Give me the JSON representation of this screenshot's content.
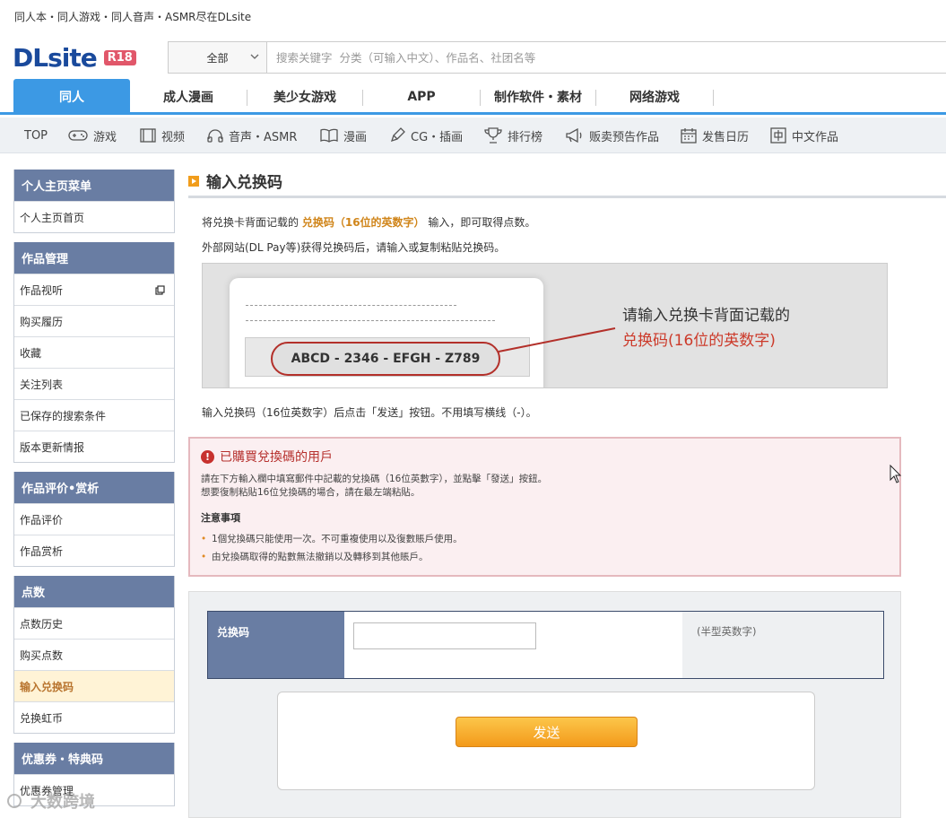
{
  "header": {
    "tagline": "同人本・同人游戏・同人音声・ASMR尽在DLsite",
    "logo_text": "DLsite",
    "logo_badge": "R18",
    "search_category": "全部",
    "search_placeholder": "搜索关键字  分类（可输入中文）、作品名、社团名等"
  },
  "main_nav": [
    "同人",
    "成人漫画",
    "美少女游戏",
    "APP",
    "制作软件・素材",
    "网络游戏"
  ],
  "sub_nav": {
    "top": "TOP",
    "items": [
      {
        "label": "游戏",
        "icon": "gamepad-icon"
      },
      {
        "label": "视频",
        "icon": "film-icon"
      },
      {
        "label": "音声・ASMR",
        "icon": "headphones-icon"
      },
      {
        "label": "漫画",
        "icon": "book-icon"
      },
      {
        "label": "CG・插画",
        "icon": "pen-icon"
      },
      {
        "label": "排行榜",
        "icon": "trophy-icon"
      },
      {
        "label": "贩卖预告作品",
        "icon": "megaphone-icon"
      },
      {
        "label": "发售日历",
        "icon": "calendar-icon"
      },
      {
        "label": "中文作品",
        "icon": "zh-icon"
      }
    ]
  },
  "sidebar": [
    {
      "title": "个人主页菜单",
      "items": [
        {
          "label": "个人主页首页"
        }
      ]
    },
    {
      "title": "作品管理",
      "items": [
        {
          "label": "作品视听",
          "external": true
        },
        {
          "label": "购买履历"
        },
        {
          "label": "收藏"
        },
        {
          "label": "关注列表"
        },
        {
          "label": "已保存的搜索条件"
        },
        {
          "label": "版本更新情报"
        }
      ]
    },
    {
      "title": "作品评价•赏析",
      "items": [
        {
          "label": "作品评价"
        },
        {
          "label": "作品赏析"
        }
      ]
    },
    {
      "title": "点数",
      "items": [
        {
          "label": "点数历史"
        },
        {
          "label": "购买点数"
        },
        {
          "label": "输入兑换码",
          "active": true
        },
        {
          "label": "兑换虹币"
        }
      ]
    },
    {
      "title": "优惠券・特典码",
      "items": [
        {
          "label": "优惠券管理"
        }
      ]
    }
  ],
  "page": {
    "title": "输入兑换码",
    "intro_prefix": "将兑换卡背面记载的",
    "intro_highlight": "兑换码（16位的英数字）",
    "intro_suffix": "输入，即可取得点数。",
    "intro2": "外部网站(DL Pay等)获得兑换码后，请输入或复制粘贴兑换码。",
    "sample_code": "ABCD - 2346 - EFGH - Z789",
    "callout_line1": "请输入兑换卡背面记载的",
    "callout_line2": "兑换码(16位的英数字)",
    "instruction": "输入兑换码（16位英数字）后点击「发送」按钮。不用填写横线（-）。"
  },
  "notice": {
    "title": "已購買兌換碼的用戶",
    "line1": "請在下方輸入欄中填寫郵件中記載的兌換碼（16位英數字），並點擊「發送」按鈕。",
    "line2": "想要復制粘貼16位兌換碼的場合，請在最左端粘貼。",
    "subtitle": "注意事項",
    "bullets": [
      "1個兌換碼只能使用一次。不可重複使用以及復數賬戶使用。",
      "由兌換碼取得的點數無法撤銷以及轉移到其他賬戶。"
    ]
  },
  "form": {
    "label": "兑换码",
    "value": "",
    "hint": "(半型英数字)",
    "submit": "发送"
  },
  "watermark": "大数跨境",
  "colors": {
    "brand_blue": "#1a4a9c",
    "nav_active": "#3c99e4",
    "sidebar_head": "#697da3",
    "highlight": "#d0851a",
    "alert_red": "#c7312e",
    "button_orange": "#f39a1b"
  }
}
